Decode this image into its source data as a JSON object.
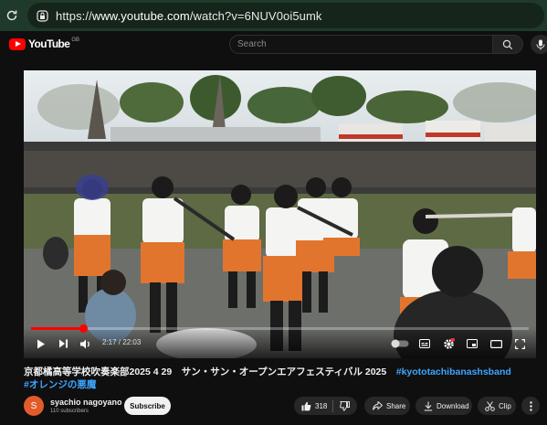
{
  "browser": {
    "url_scheme": "https://",
    "url_host": "www.youtube.com",
    "url_path": "/watch?v=6NUV0oi5umk"
  },
  "header": {
    "logo_text": "YouTube",
    "logo_country": "GB",
    "search_placeholder": "Search"
  },
  "player": {
    "current_time": "2:17",
    "duration": "22:03",
    "progress_fraction": 0.104
  },
  "video": {
    "title_main": "京都橘高等学校吹奏楽部2025 4 29　サン・サン・オープンエアフェスティバル 2025　",
    "hashtag_1": "#kyototachibanashsband",
    "hashtag_2": "#オレンジの悪魔"
  },
  "channel": {
    "avatar_letter": "S",
    "name": "syachio nagoyano",
    "subscribers": "110 subscribers",
    "subscribe_label": "Subscribe"
  },
  "actions": {
    "like_count": "318",
    "share_label": "Share",
    "download_label": "Download",
    "clip_label": "Clip"
  },
  "colors": {
    "brand_red": "#ff0000",
    "link_blue": "#3ea6ff",
    "avatar_orange": "#e25b2b"
  }
}
